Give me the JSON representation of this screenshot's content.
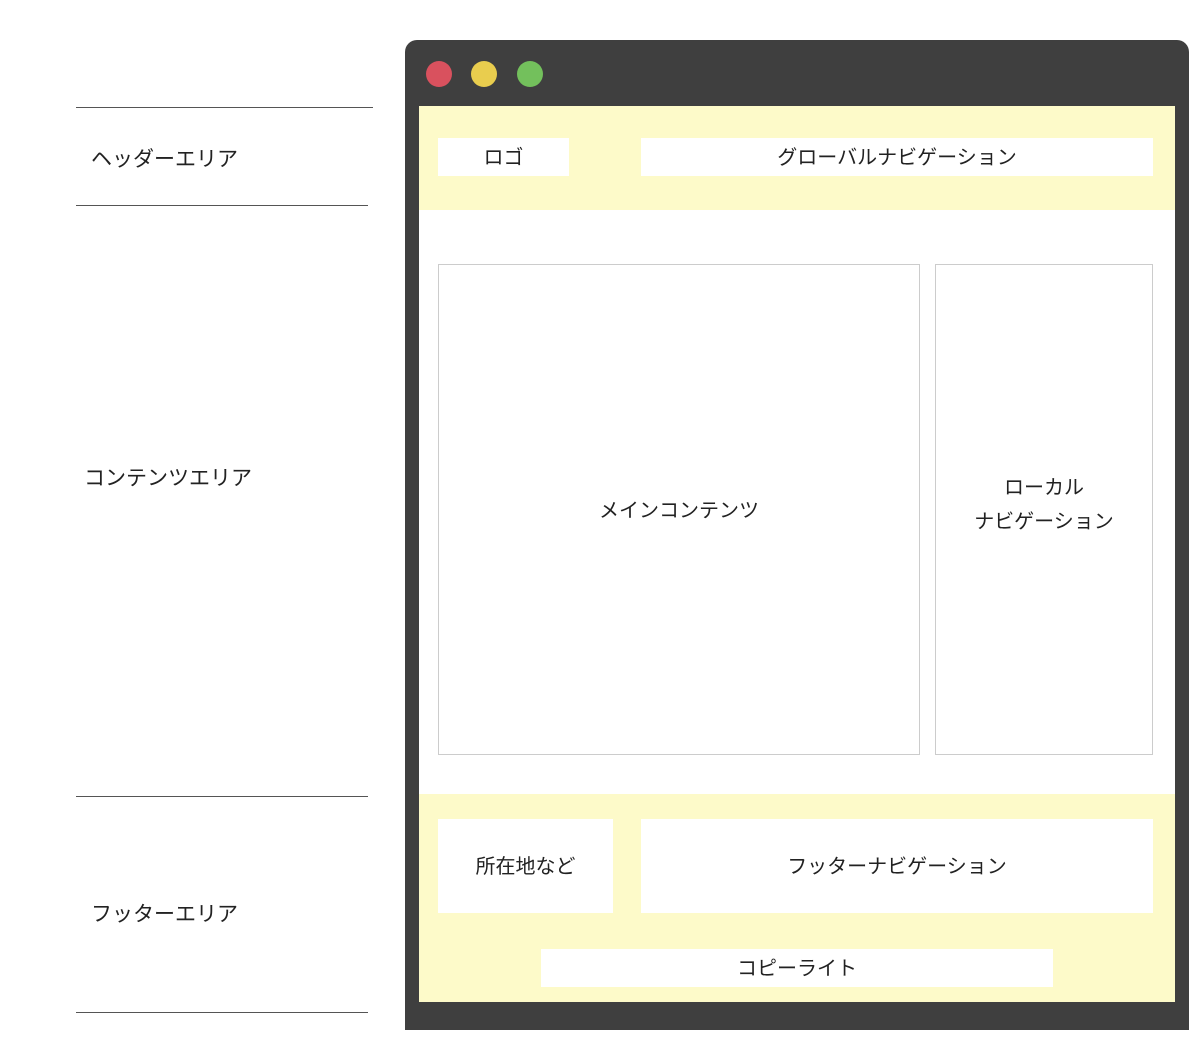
{
  "annotations": {
    "header_area": "ヘッダーエリア",
    "content_area": "コンテンツエリア",
    "footer_area": "フッターエリア"
  },
  "window": {
    "controls": [
      "close",
      "minimize",
      "maximize"
    ],
    "colors": {
      "close": "#d9515e",
      "minimize": "#e9cd4e",
      "maximize": "#73c05c",
      "frame": "#3f3f3f",
      "zone_fill": "#fdfac9"
    }
  },
  "header": {
    "logo": "ロゴ",
    "global_nav": "グローバルナビゲーション"
  },
  "content": {
    "main": "メインコンテンツ",
    "local_nav_line1": "ローカル",
    "local_nav_line2": "ナビゲーション"
  },
  "footer": {
    "address": "所在地など",
    "footer_nav": "フッターナビゲーション",
    "copyright": "コピーライト"
  }
}
